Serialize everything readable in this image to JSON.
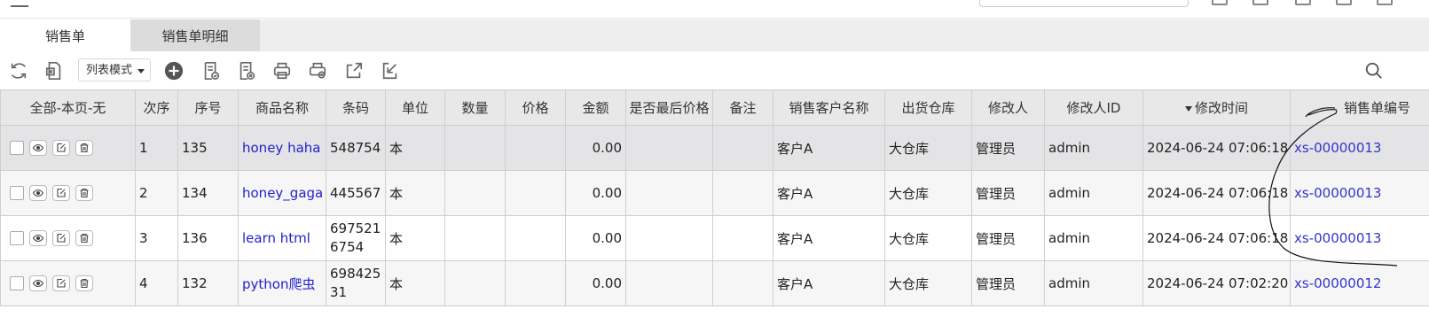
{
  "tabs": [
    {
      "label": "销售单"
    },
    {
      "label": "销售单明细"
    }
  ],
  "toolbar": {
    "mode_label": "列表模式"
  },
  "table": {
    "select_all_label": "全部-本页-无",
    "headers": [
      "次序",
      "序号",
      "商品名称",
      "条码",
      "单位",
      "数量",
      "价格",
      "金额",
      "是否最后价格",
      "备注",
      "销售客户名称",
      "出货仓库",
      "修改人",
      "修改人ID",
      "修改时间",
      "销售单编号"
    ],
    "sorted_column": "修改时间",
    "rows": [
      {
        "order": "1",
        "seq": "135",
        "product": "honey haha",
        "barcode": "548754",
        "unit": "本",
        "qty": "",
        "price": "",
        "amount": "0.00",
        "is_last_price": "",
        "remark": "",
        "customer": "客户A",
        "warehouse": "大仓库",
        "modifier": "管理员",
        "modifier_id": "admin",
        "modified_time": "2024-06-24 07:06:18",
        "order_no": "xs-00000013"
      },
      {
        "order": "2",
        "seq": "134",
        "product": "honey_gaga",
        "barcode": "445567",
        "unit": "本",
        "qty": "",
        "price": "",
        "amount": "0.00",
        "is_last_price": "",
        "remark": "",
        "customer": "客户A",
        "warehouse": "大仓库",
        "modifier": "管理员",
        "modifier_id": "admin",
        "modified_time": "2024-06-24 07:06:18",
        "order_no": "xs-00000013"
      },
      {
        "order": "3",
        "seq": "136",
        "product": "learn html",
        "barcode": "6975216754",
        "unit": "本",
        "qty": "",
        "price": "",
        "amount": "0.00",
        "is_last_price": "",
        "remark": "",
        "customer": "客户A",
        "warehouse": "大仓库",
        "modifier": "管理员",
        "modifier_id": "admin",
        "modified_time": "2024-06-24 07:06:18",
        "order_no": "xs-00000013"
      },
      {
        "order": "4",
        "seq": "132",
        "product": "python爬虫",
        "barcode": "69842531",
        "unit": "本",
        "qty": "",
        "price": "",
        "amount": "0.00",
        "is_last_price": "",
        "remark": "",
        "customer": "客户A",
        "warehouse": "大仓库",
        "modifier": "管理员",
        "modifier_id": "admin",
        "modified_time": "2024-06-24 07:02:20",
        "order_no": "xs-00000012"
      }
    ]
  },
  "icons": {
    "toolbar": [
      "refresh-icon",
      "export-excel-icon",
      "add-circle-icon",
      "approve-doc-icon",
      "cancel-doc-icon",
      "print-icon",
      "print-preview-icon",
      "share-export-icon",
      "import-icon",
      "search-icon"
    ],
    "row_actions": [
      "view-eye-icon",
      "edit-icon",
      "delete-trash-icon"
    ]
  },
  "colors": {
    "link": "#2222cc",
    "header_bg": "#e8e8e8",
    "tab_inactive": "#dcdcdc",
    "selected_row": "#e4e4e6"
  }
}
